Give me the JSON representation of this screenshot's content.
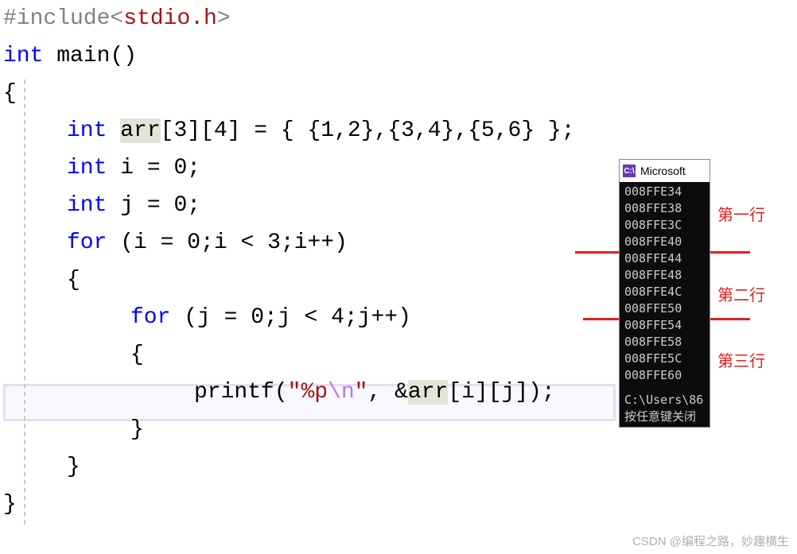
{
  "code": {
    "include_directive": "#include",
    "include_header": "stdio.h",
    "line2_kw_int": "int",
    "line2_main": "main",
    "line2_parens": "()",
    "brace_open": "{",
    "brace_close": "}",
    "decl_arr_type": "int",
    "decl_arr_name": "arr",
    "decl_arr_dims": "[3][4] = { {1,2},{3,4},{5,6} };",
    "decl_i": "i = 0;",
    "decl_j": "j = 0;",
    "for_kw": "for",
    "for_outer": "(i = 0;i < 3;i++)",
    "for_inner": "(j = 0;j < 4;j++)",
    "printf_name": "printf",
    "printf_open": "(",
    "printf_fmt1": "\"%p",
    "printf_escape": "\\n",
    "printf_fmt2": "\"",
    "printf_mid": ", &",
    "printf_arr": "arr",
    "printf_idx": "[i][j]);"
  },
  "console": {
    "title": "Microsoft",
    "lines": [
      "008FFE34",
      "008FFE38",
      "008FFE3C",
      "008FFE40",
      "008FFE44",
      "008FFE48",
      "008FFE4C",
      "008FFE50",
      "008FFE54",
      "008FFE58",
      "008FFE5C",
      "008FFE60"
    ],
    "path": "C:\\Users\\86",
    "prompt": "按任意键关闭"
  },
  "annotations": {
    "row1": "第一行",
    "row2": "第二行",
    "row3": "第三行"
  },
  "watermark": "CSDN @编程之路，妙趣横生"
}
